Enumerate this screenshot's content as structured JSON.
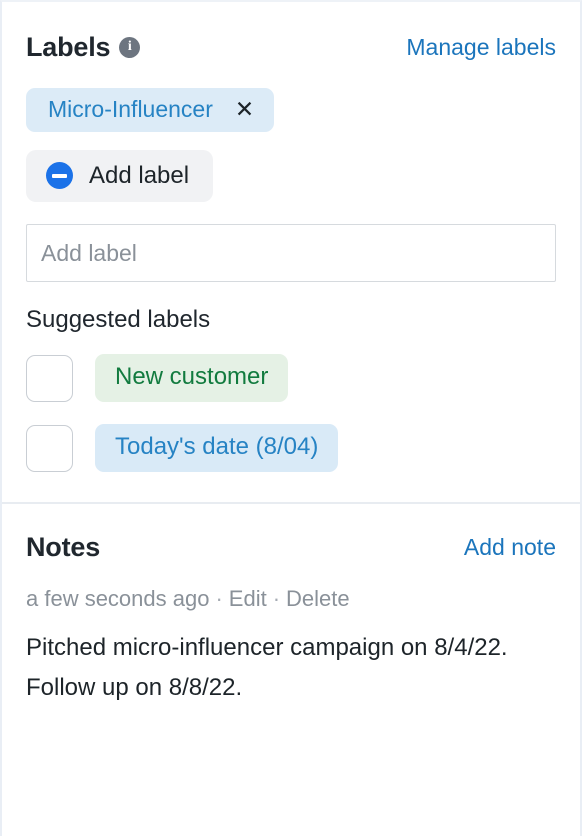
{
  "labels": {
    "title": "Labels",
    "info_icon": "info-icon",
    "manage_link": "Manage labels",
    "applied": [
      {
        "text": "Micro-Influencer",
        "close": "✕",
        "color": "#2683c4",
        "bg": "#dcebf7"
      }
    ],
    "add_button": {
      "label": "Add label",
      "icon": "minus-circle-icon",
      "icon_color": "#1b72e8"
    },
    "input": {
      "value": "",
      "placeholder": "Add label"
    },
    "suggested_title": "Suggested labels",
    "suggested": [
      {
        "text": "New customer",
        "checked": false,
        "variant": "green",
        "color": "#127b3f",
        "bg": "#e5f1e5"
      },
      {
        "text": "Today's date (8/04)",
        "checked": false,
        "variant": "blue",
        "color": "#2683c4",
        "bg": "#d9eaf7"
      }
    ]
  },
  "notes": {
    "title": "Notes",
    "add_link": "Add note",
    "items": [
      {
        "timestamp": "a few seconds ago",
        "separator": "·",
        "edit_label": "Edit",
        "delete_label": "Delete",
        "body": "Pitched micro-influencer campaign on 8/4/22. Follow up on 8/8/22."
      }
    ]
  },
  "theme": {
    "link_color": "#1b75bc",
    "heading_color": "#20272e",
    "muted_color": "#8a9199",
    "divider_color": "#e8ecf1"
  }
}
